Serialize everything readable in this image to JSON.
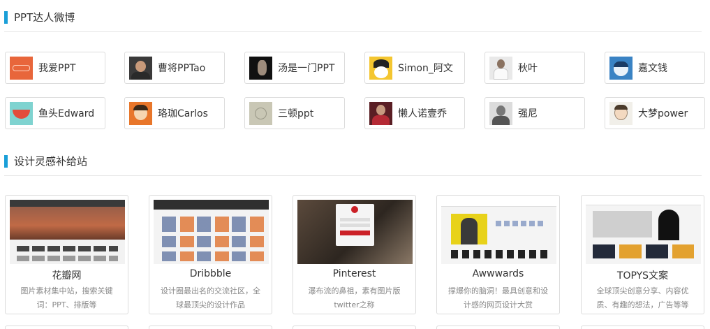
{
  "sections": [
    {
      "title": "PPT达人微博"
    },
    {
      "title": "设计灵感补给站"
    }
  ],
  "weibo_users": [
    {
      "name": "我爱PPT",
      "avatar": "logo-avatar"
    },
    {
      "name": "曹将PPTao",
      "avatar": "person-avatar"
    },
    {
      "name": "汤是一门PPT",
      "avatar": "person-avatar"
    },
    {
      "name": "Simon_阿文",
      "avatar": "cartoon-avatar"
    },
    {
      "name": "秋叶",
      "avatar": "person-avatar"
    },
    {
      "name": "嘉文钱",
      "avatar": "cartoon-avatar"
    },
    {
      "name": "鱼头Edward",
      "avatar": "bowl-avatar"
    },
    {
      "name": "珞珈Carlos",
      "avatar": "cartoon-avatar"
    },
    {
      "name": "三顿ppt",
      "avatar": "sketch-avatar"
    },
    {
      "name": "懒人诺壹乔",
      "avatar": "person-avatar"
    },
    {
      "name": "强尼",
      "avatar": "person-avatar"
    },
    {
      "name": "大梦power",
      "avatar": "cartoon-avatar"
    }
  ],
  "sites": [
    {
      "title": "花瓣网",
      "desc": "图片素材集中站，搜索关键词：PPT、排版等"
    },
    {
      "title": "Dribbble",
      "desc": "设计圈最出名的交流社区，全球最顶尖的设计作品"
    },
    {
      "title": "Pinterest",
      "desc": "瀑布流的鼻祖，素有图片版twitter之称"
    },
    {
      "title": "Awwwards",
      "desc": "撑爆你的脑洞！最具创意和设计感的网页设计大赏"
    },
    {
      "title": "TOPYS文案",
      "desc": "全球顶尖创意分享、内容优质、有趣的想法，广告等等"
    }
  ],
  "colors": {
    "accent": "#1a9fd8",
    "border": "#dcdcdc",
    "text": "#333333",
    "muted": "#888888"
  }
}
